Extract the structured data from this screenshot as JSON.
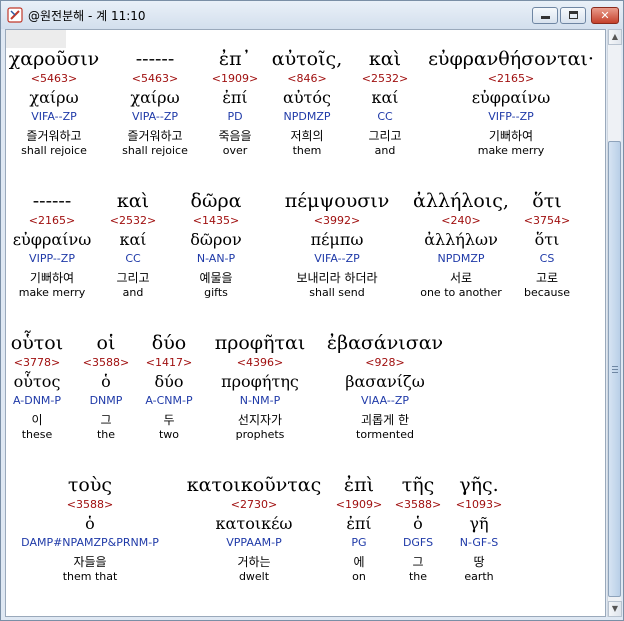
{
  "window": {
    "title": "@원전분해 - 계 11:10",
    "minimize_glyph": "",
    "maximize_glyph": "",
    "close_glyph": "✕"
  },
  "scroll": {
    "up_glyph": "▲",
    "down_glyph": "▼"
  },
  "lines": [
    [
      {
        "greek": "χαροῦσιν",
        "strong": "<5463>",
        "lemma": "χαίρω",
        "parse": "VIFA--ZP",
        "korean": "즐거워하고",
        "english": "shall rejoice"
      },
      {
        "greek": "------",
        "strong": "<5463>",
        "lemma": "χαίρω",
        "parse": "VIPA--ZP",
        "korean": "즐거워하고",
        "english": "shall rejoice"
      },
      {
        "greek": "ἐπ᾽",
        "strong": "<1909>",
        "lemma": "ἐπί",
        "parse": "PD",
        "korean": "죽음을",
        "english": "over"
      },
      {
        "greek": "αὐτοῖς,",
        "strong": "<846>",
        "lemma": "αὐτός",
        "parse": "NPDMZP",
        "korean": "저희의",
        "english": "them"
      },
      {
        "greek": "καὶ",
        "strong": "<2532>",
        "lemma": "καί",
        "parse": "CC",
        "korean": "그리고",
        "english": "and"
      },
      {
        "greek": "εὐφρανθήσονται·",
        "strong": "<2165>",
        "lemma": "εὐφραίνω",
        "parse": "VIFP--ZP",
        "korean": "기뻐하여",
        "english": "make merry"
      }
    ],
    [
      {
        "greek": "------",
        "strong": "<2165>",
        "lemma": "εὐφραίνω",
        "parse": "VIPP--ZP",
        "korean": "기뻐하여",
        "english": "make merry"
      },
      {
        "greek": "καὶ",
        "strong": "<2532>",
        "lemma": "καί",
        "parse": "CC",
        "korean": "그리고",
        "english": "and"
      },
      {
        "greek": "δῶρα",
        "strong": "<1435>",
        "lemma": "δῶρον",
        "parse": "N-AN-P",
        "korean": "예물을",
        "english": "gifts"
      },
      {
        "greek": "πέμψουσιν",
        "strong": "<3992>",
        "lemma": "πέμπω",
        "parse": "VIFA--ZP",
        "korean": "보내리라 하더라",
        "english": "shall send"
      },
      {
        "greek": "ἀλλήλοις,",
        "strong": "<240>",
        "lemma": "ἀλλήλων",
        "parse": "NPDMZP",
        "korean": "서로",
        "english": "one to another"
      },
      {
        "greek": "ὅτι",
        "strong": "<3754>",
        "lemma": "ὅτι",
        "parse": "CS",
        "korean": "고로",
        "english": "because"
      }
    ],
    [
      {
        "greek": "οὗτοι",
        "strong": "<3778>",
        "lemma": "οὗτος",
        "parse": "A-DNM-P",
        "korean": "이",
        "english": "these"
      },
      {
        "greek": "οἱ",
        "strong": "<3588>",
        "lemma": "ὁ",
        "parse": "DNMP",
        "korean": "그",
        "english": "the"
      },
      {
        "greek": "δύο",
        "strong": "<1417>",
        "lemma": "δύο",
        "parse": "A-CNM-P",
        "korean": "두",
        "english": "two"
      },
      {
        "greek": "προφῆται",
        "strong": "<4396>",
        "lemma": "προφήτης",
        "parse": "N-NM-P",
        "korean": "선지자가",
        "english": "prophets"
      },
      {
        "greek": "ἐβασάνισαν",
        "strong": "<928>",
        "lemma": "βασανίζω",
        "parse": "VIAA--ZP",
        "korean": "괴롭게 한",
        "english": "tormented"
      }
    ],
    [
      {
        "greek": "τοὺς",
        "strong": "<3588>",
        "lemma": "ὁ",
        "parse": "DAMP#NPAMZP&PRNM-P",
        "korean": "자들을",
        "english": "them that"
      },
      {
        "greek": "κατοικοῦντας",
        "strong": "<2730>",
        "lemma": "κατοικέω",
        "parse": "VPPAAM-P",
        "korean": "거하는",
        "english": "dwelt"
      },
      {
        "greek": "ἐπὶ",
        "strong": "<1909>",
        "lemma": "ἐπί",
        "parse": "PG",
        "korean": "에",
        "english": "on"
      },
      {
        "greek": "τῆς",
        "strong": "<3588>",
        "lemma": "ὁ",
        "parse": "DGFS",
        "korean": "그",
        "english": "the"
      },
      {
        "greek": "γῆς.",
        "strong": "<1093>",
        "lemma": "γῆ",
        "parse": "N-GF-S",
        "korean": "땅",
        "english": "earth"
      }
    ]
  ]
}
